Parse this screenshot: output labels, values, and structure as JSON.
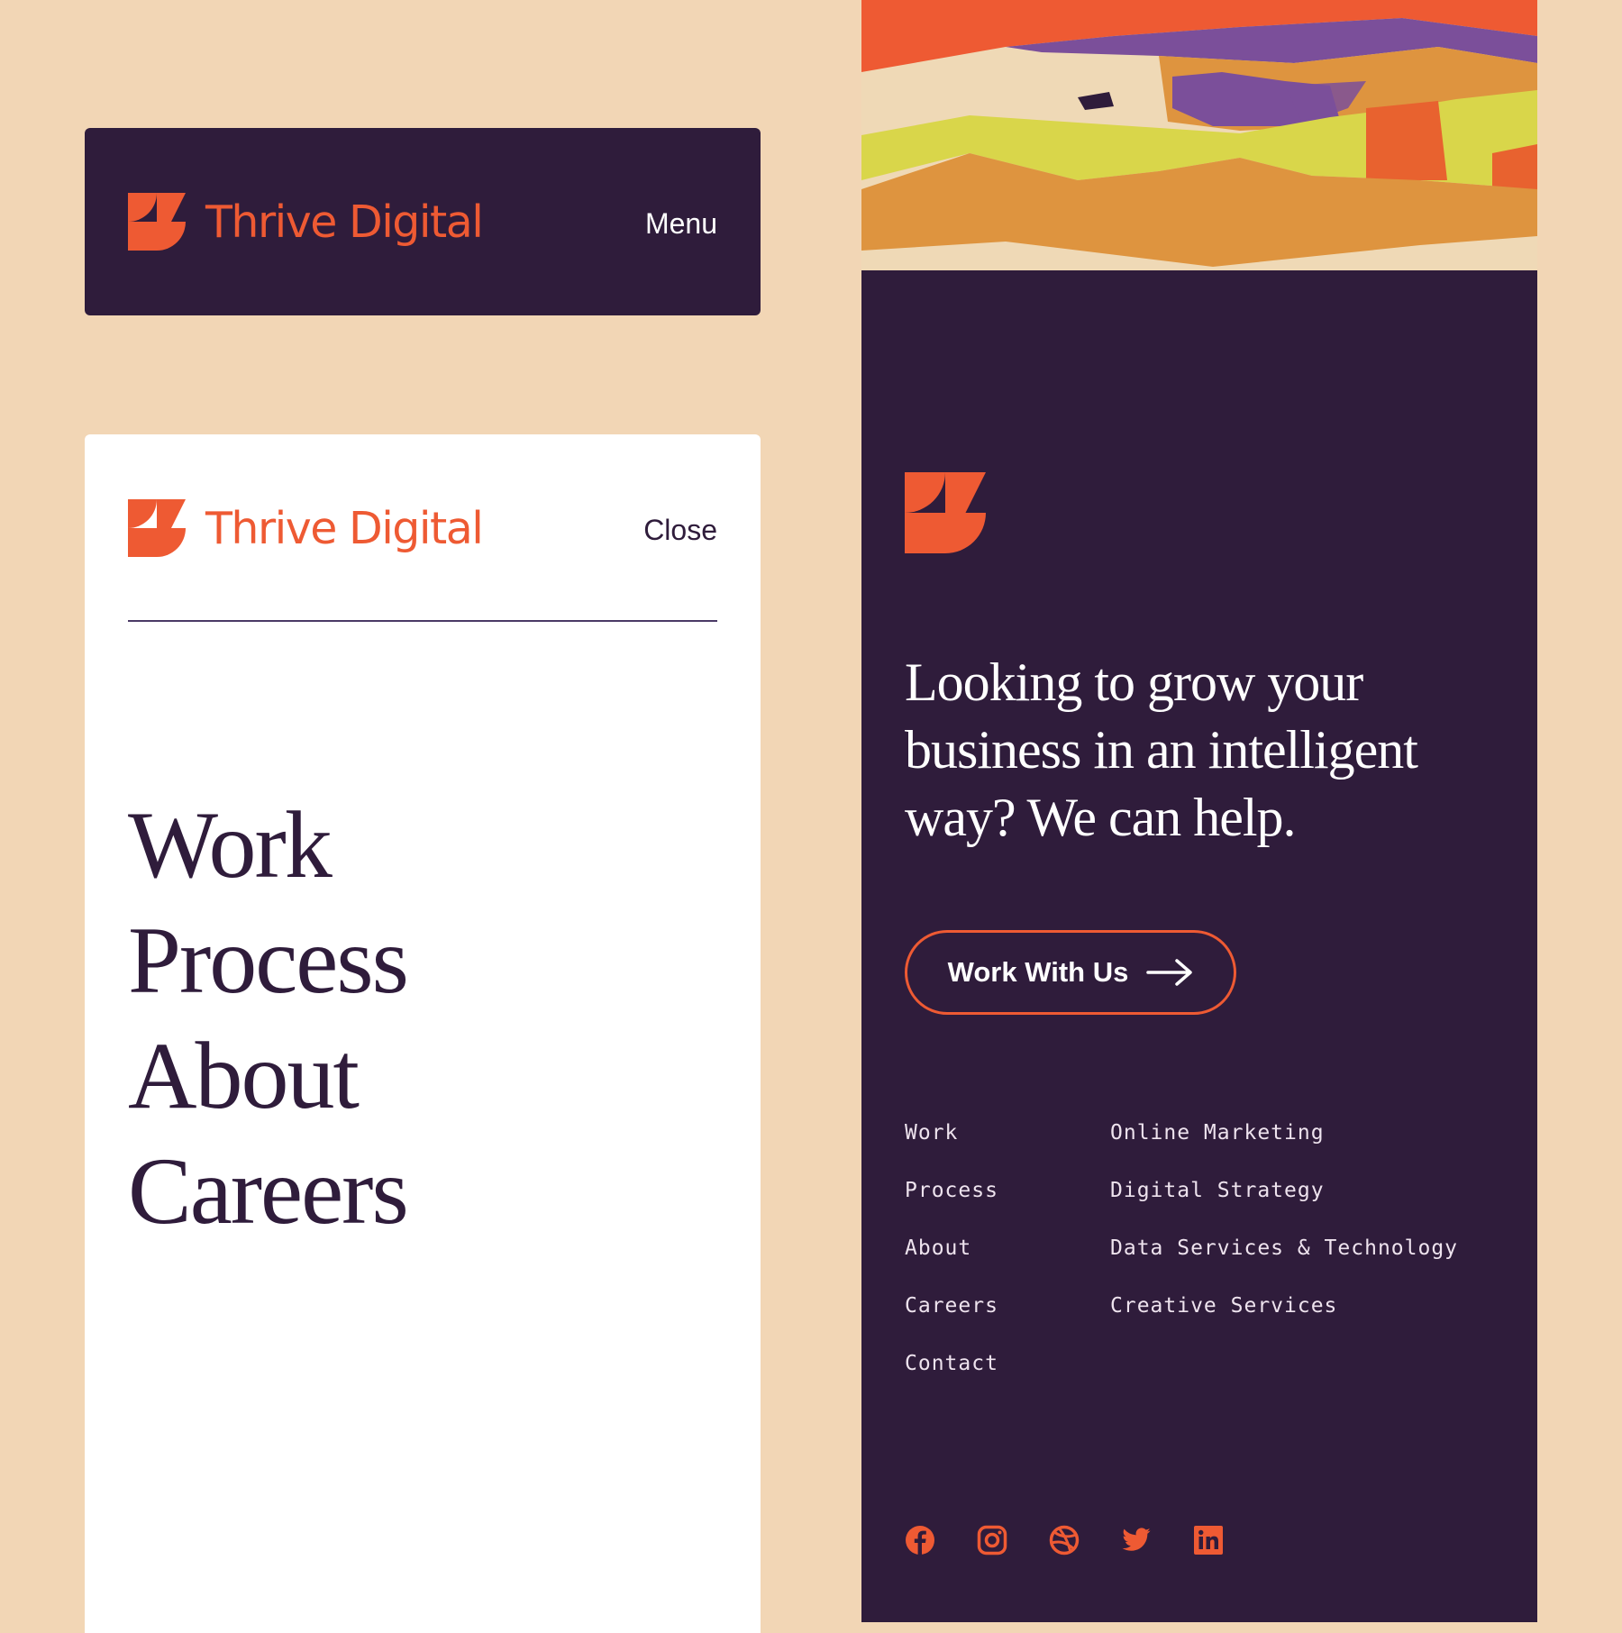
{
  "brand": {
    "name": "Thrive Digital"
  },
  "header_closed": {
    "toggle_label": "Menu"
  },
  "menu_open": {
    "toggle_label": "Close",
    "nav": [
      "Work",
      "Process",
      "About",
      "Careers"
    ]
  },
  "footer": {
    "tagline": "Looking to grow your business in an intelligent way? We can help.",
    "cta_label": "Work With Us",
    "links": [
      "Work",
      "Process",
      "About",
      "Careers",
      "Contact"
    ],
    "services": [
      "Online Marketing",
      "Digital Strategy",
      "Data Services & Technology",
      "Creative Services"
    ],
    "social": [
      "facebook-icon",
      "instagram-icon",
      "dribbble-icon",
      "twitter-icon",
      "linkedin-icon"
    ]
  },
  "colors": {
    "background": "#F2D6B5",
    "brand_dark": "#2F1C3B",
    "accent": "#EE5A33",
    "white": "#FFFFFF",
    "art_purple": "#7B4F9A",
    "art_yellow": "#D9D64A",
    "art_orange": "#DE943F",
    "art_cream": "#EFD9B6"
  }
}
